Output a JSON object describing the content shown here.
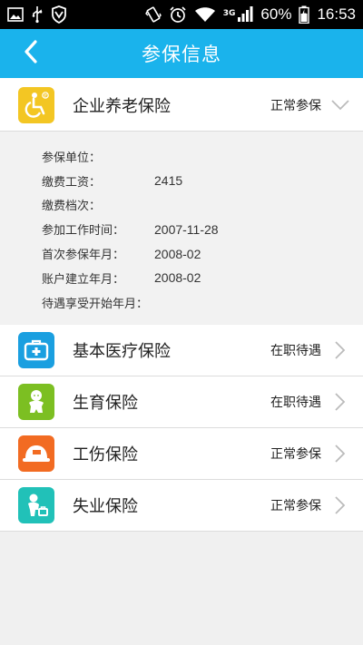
{
  "status_bar": {
    "battery": "60%",
    "time": "16:53",
    "network": "3G",
    "icons": [
      "image-icon",
      "usb-icon",
      "shield-icon",
      "vibrate-icon",
      "alarm-icon",
      "wifi-icon",
      "signal-icon",
      "battery-icon"
    ]
  },
  "header": {
    "title": "参保信息",
    "back_icon": "chevron-left-icon"
  },
  "colors": {
    "header_bg": "#1ab3ec",
    "pension_icon_bg": "#f3c623",
    "medical_icon_bg": "#1a9fe0",
    "maternity_icon_bg": "#7cbf22",
    "injury_icon_bg": "#f26b22",
    "unemployment_icon_bg": "#21c1b8"
  },
  "pension": {
    "label": "企业养老保险",
    "status": "正常参保",
    "icon": "wheelchair-icon",
    "details": [
      {
        "label": "参保单位：",
        "value": ""
      },
      {
        "label": "缴费工资：",
        "value": "2415"
      },
      {
        "label": "缴费档次：",
        "value": ""
      },
      {
        "label": "参加工作时间：",
        "value": "2007-11-28"
      },
      {
        "label": "首次参保年月：",
        "value": "2008-02"
      },
      {
        "label": "账户建立年月：",
        "value": "2008-02"
      },
      {
        "label": "待遇享受开始年月：",
        "value": ""
      }
    ]
  },
  "insurances": [
    {
      "label": "基本医疗保险",
      "status": "在职待遇",
      "icon": "medical-kit-icon"
    },
    {
      "label": "生育保险",
      "status": "在职待遇",
      "icon": "baby-icon"
    },
    {
      "label": "工伤保险",
      "status": "正常参保",
      "icon": "hard-hat-icon"
    },
    {
      "label": "失业保险",
      "status": "正常参保",
      "icon": "unemployed-person-icon"
    }
  ]
}
